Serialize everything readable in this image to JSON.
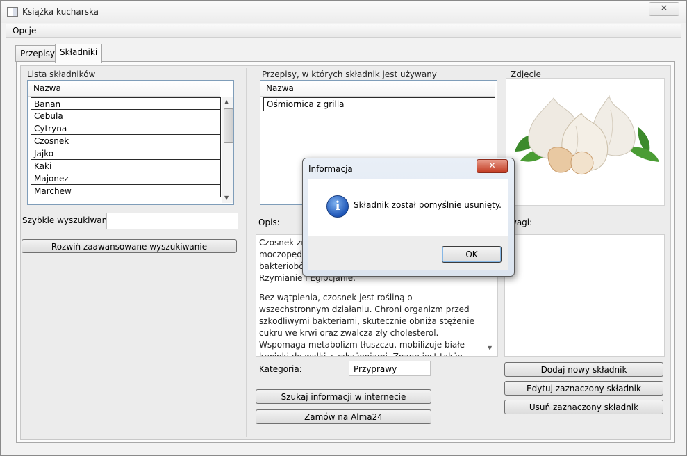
{
  "window": {
    "title": "Książka kucharska",
    "close_glyph": "✕"
  },
  "menu": {
    "options": "Opcje"
  },
  "tabs": [
    {
      "label": "Przepisy"
    },
    {
      "label": "Składniki"
    }
  ],
  "ingredients": {
    "group_label": "Lista składników",
    "column_header": "Nazwa",
    "items": [
      "Banan",
      "Cebula",
      "Cytryna",
      "Czosnek",
      "Jajko",
      "Kaki",
      "Majonez",
      "Marchew"
    ]
  },
  "quick_search": {
    "label": "Szybkie wyszukiwanie:",
    "value": ""
  },
  "advanced_search_button": "Rozwiń zaawansowane wyszukiwanie",
  "recipes": {
    "group_label": "Przepisy, w których składnik jest używany",
    "column_header": "Nazwa",
    "items": [
      "Ośmiornica z grilla"
    ]
  },
  "photo": {
    "label": "Zdjęcie",
    "icon": "garlic-photo"
  },
  "description": {
    "label": "Opis:",
    "lines_top": [
      "Czosnek zna",
      "moczopędn",
      "bakteriobój",
      "Rzymianie i Egipcjanie."
    ],
    "paragraph": "Bez wątpienia, czosnek jest rośliną o wszechstronnym działaniu. Chroni organizm przed szkodliwymi bakteriami, skutecznie obniża stężenie cukru we krwi oraz zwalcza zły cholesterol. Wspomaga metabolizm tłuszczu, mobilizuje białe krwinki do walki z zakażeniami. Znane jest także działanie czosnku żółciopędne, rozkurczowe"
  },
  "notes": {
    "label_partial": "wagi:",
    "value": ""
  },
  "category": {
    "label": "Kategoria:",
    "value": "Przyprawy"
  },
  "buttons": {
    "search_internet": "Szukaj informacji w internecie",
    "order_alma": "Zamów na Alma24",
    "add_ingredient": "Dodaj nowy składnik",
    "edit_ingredient": "Edytuj zaznaczony składnik",
    "delete_ingredient": "Usuń zaznaczony składnik"
  },
  "dialog": {
    "title": "Informacja",
    "close_glyph": "✕",
    "icon": "info-icon",
    "message": "Składnik został pomyślnie usunięty.",
    "ok": "OK",
    "icon_letter": "i"
  }
}
